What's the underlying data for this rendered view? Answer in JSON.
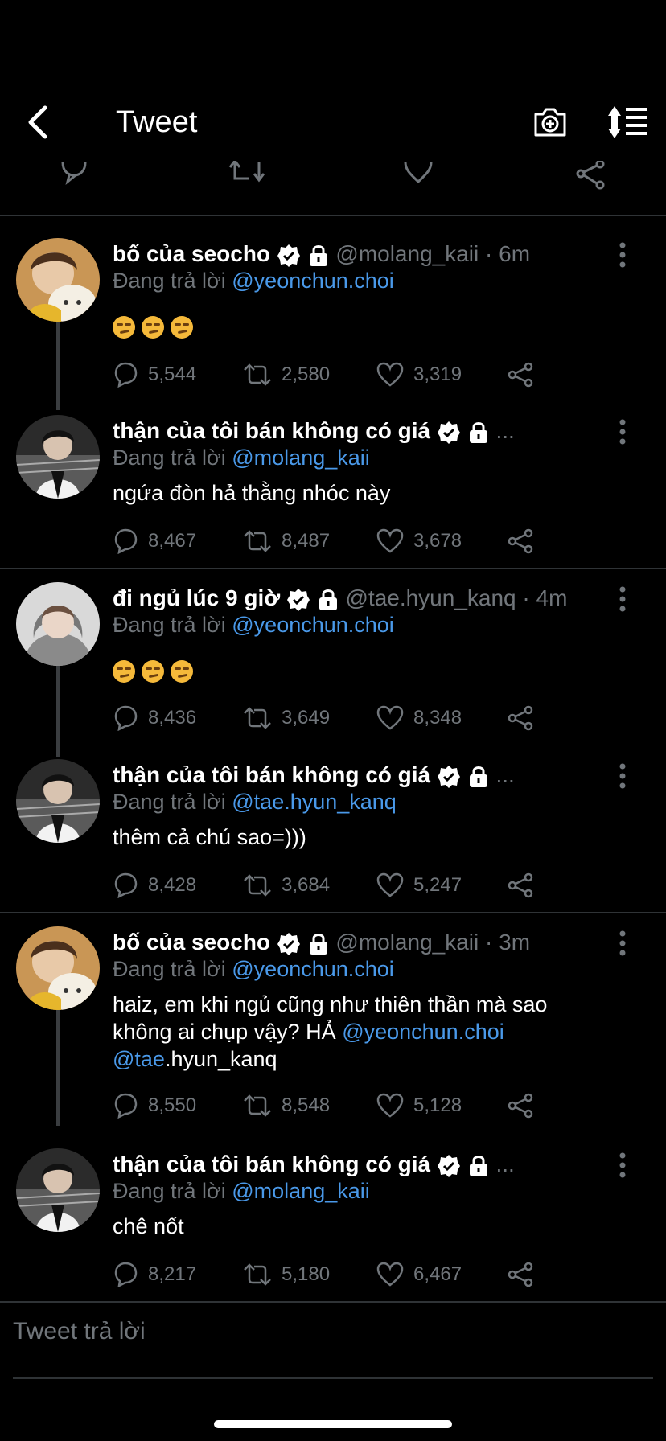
{
  "header": {
    "title": "Tweet"
  },
  "colors": {
    "background": "#000000",
    "text": "#ffffff",
    "muted": "#71767b",
    "link": "#4a99e9",
    "divider": "#2f3336"
  },
  "tweets": [
    {
      "name": "bố của seocho",
      "handle": "@molang_kaii · 6m",
      "reply_prefix": "Đang trả lời ",
      "reply_to": "@yeonchun.choi",
      "emoji_count": 3,
      "text": "",
      "replies": "5,544",
      "retweets": "2,580",
      "likes": "3,319",
      "avatar": "avatar-yellow-hood"
    },
    {
      "name": "thận của tôi bán không có giá",
      "handle": "...",
      "reply_prefix": "Đang trả lời ",
      "reply_to": "@molang_kaii",
      "emoji_count": 0,
      "text": "ngứa đòn hả thằng nhóc này",
      "replies": "8,467",
      "retweets": "8,487",
      "likes": "3,678",
      "avatar": "avatar-piano"
    },
    {
      "name": "đi ngủ lúc 9 giờ",
      "handle": "@tae.hyun_kanq · 4m",
      "reply_prefix": "Đang trả lời ",
      "reply_to": "@yeonchun.choi",
      "emoji_count": 3,
      "text": "",
      "replies": "8,436",
      "retweets": "3,649",
      "likes": "8,348",
      "avatar": "avatar-grey-hoodie"
    },
    {
      "name": "thận của tôi bán không có giá",
      "handle": "...",
      "reply_prefix": "Đang trả lời ",
      "reply_to": "@tae.hyun_kanq",
      "emoji_count": 0,
      "text": "thêm cả chú sao=)))",
      "replies": "8,428",
      "retweets": "3,684",
      "likes": "5,247",
      "avatar": "avatar-piano"
    },
    {
      "name": "bố của seocho",
      "handle": "@molang_kaii · 3m",
      "reply_prefix": "Đang trả lời ",
      "reply_to": "@yeonchun.choi",
      "emoji_count": 0,
      "text_line1": "haiz, em khi ngủ cũng như thiên thần mà sao",
      "text_line2a": "không ai chụp vậy? HẢ ",
      "text_line2b": "@yeonchun.choi",
      "text_line3a": "@tae",
      "text_line3b": ".hyun_kanq",
      "replies": "8,550",
      "retweets": "8,548",
      "likes": "5,128",
      "avatar": "avatar-yellow-hood"
    },
    {
      "name": "thận của tôi bán không có giá",
      "handle": "...",
      "reply_prefix": "Đang trả lời ",
      "reply_to": "@molang_kaii",
      "emoji_count": 0,
      "text": "chê nốt",
      "replies": "8,217",
      "retweets": "5,180",
      "likes": "6,467",
      "avatar": "avatar-piano"
    }
  ],
  "composer": {
    "placeholder": "Tweet trả lời"
  }
}
